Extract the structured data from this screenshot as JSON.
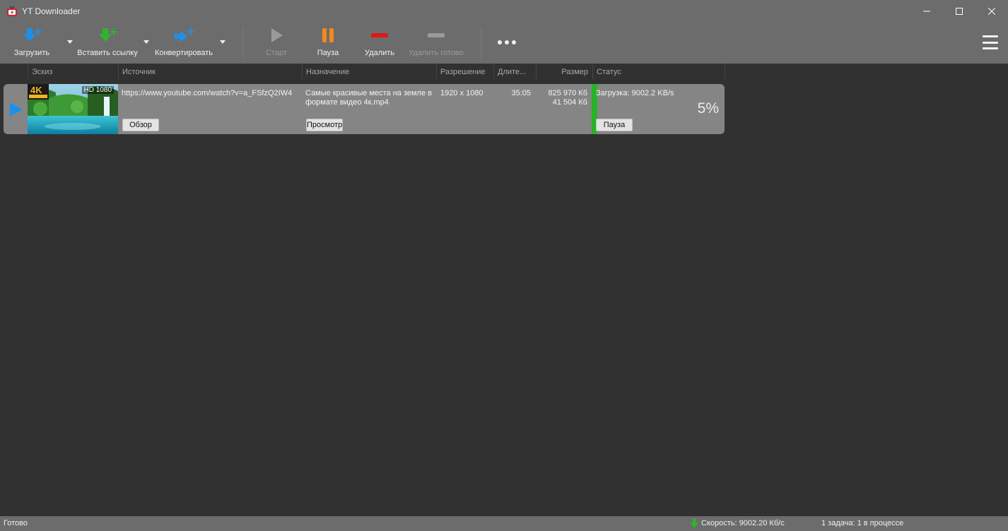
{
  "window": {
    "title": "YT Downloader",
    "icon": "tv-icon"
  },
  "toolbar": {
    "download_label": "Загрузить",
    "paste_link_label": "Вставить ссылку",
    "convert_label": "Конвертировать",
    "start_label": "Старт",
    "pause_label": "Пауза",
    "delete_label": "Удалить",
    "delete_done_label": "Удалить готово",
    "more_icon": "more-dots-icon",
    "menu_icon": "hamburger-menu-icon"
  },
  "columns": {
    "thumbnail": "Эскиз",
    "source": "Источник",
    "destination": "Назначение",
    "resolution": "Разрешение",
    "duration": "Длите...",
    "size": "Размер",
    "status": "Статус"
  },
  "downloads": [
    {
      "thumbnail_badge_quality": "HD 1080",
      "thumbnail_badge_4k": "4K",
      "source_url": "https://www.youtube.com/watch?v=a_FSfzQ2IW4",
      "browse_button": "Обзор",
      "destination_line1": "Самые красивые места на земле в",
      "destination_line2": "формате видео 4к.mp4",
      "view_button": "Просмотр",
      "resolution": "1920 x 1080",
      "duration": "35:05",
      "size_total": "825 970 Кб",
      "size_downloaded": "41 504 Кб",
      "status_text": "Загрузка: 9002.2 KB/s",
      "status_button": "Пауза",
      "progress_percent_label": "5%",
      "progress": 0.05
    }
  ],
  "statusbar": {
    "left": "Готово",
    "speed": "Скорость: 9002.20 Кб/с",
    "tasks": "1 задача: 1 в процессе"
  },
  "colors": {
    "accent_blue": "#1e90e8",
    "accent_green": "#2db52d",
    "pause_orange": "#f08a1c",
    "delete_red": "#e01818",
    "toolbar_bg": "#6c6c6c",
    "content_bg": "#313131",
    "row_bg": "#858585"
  }
}
